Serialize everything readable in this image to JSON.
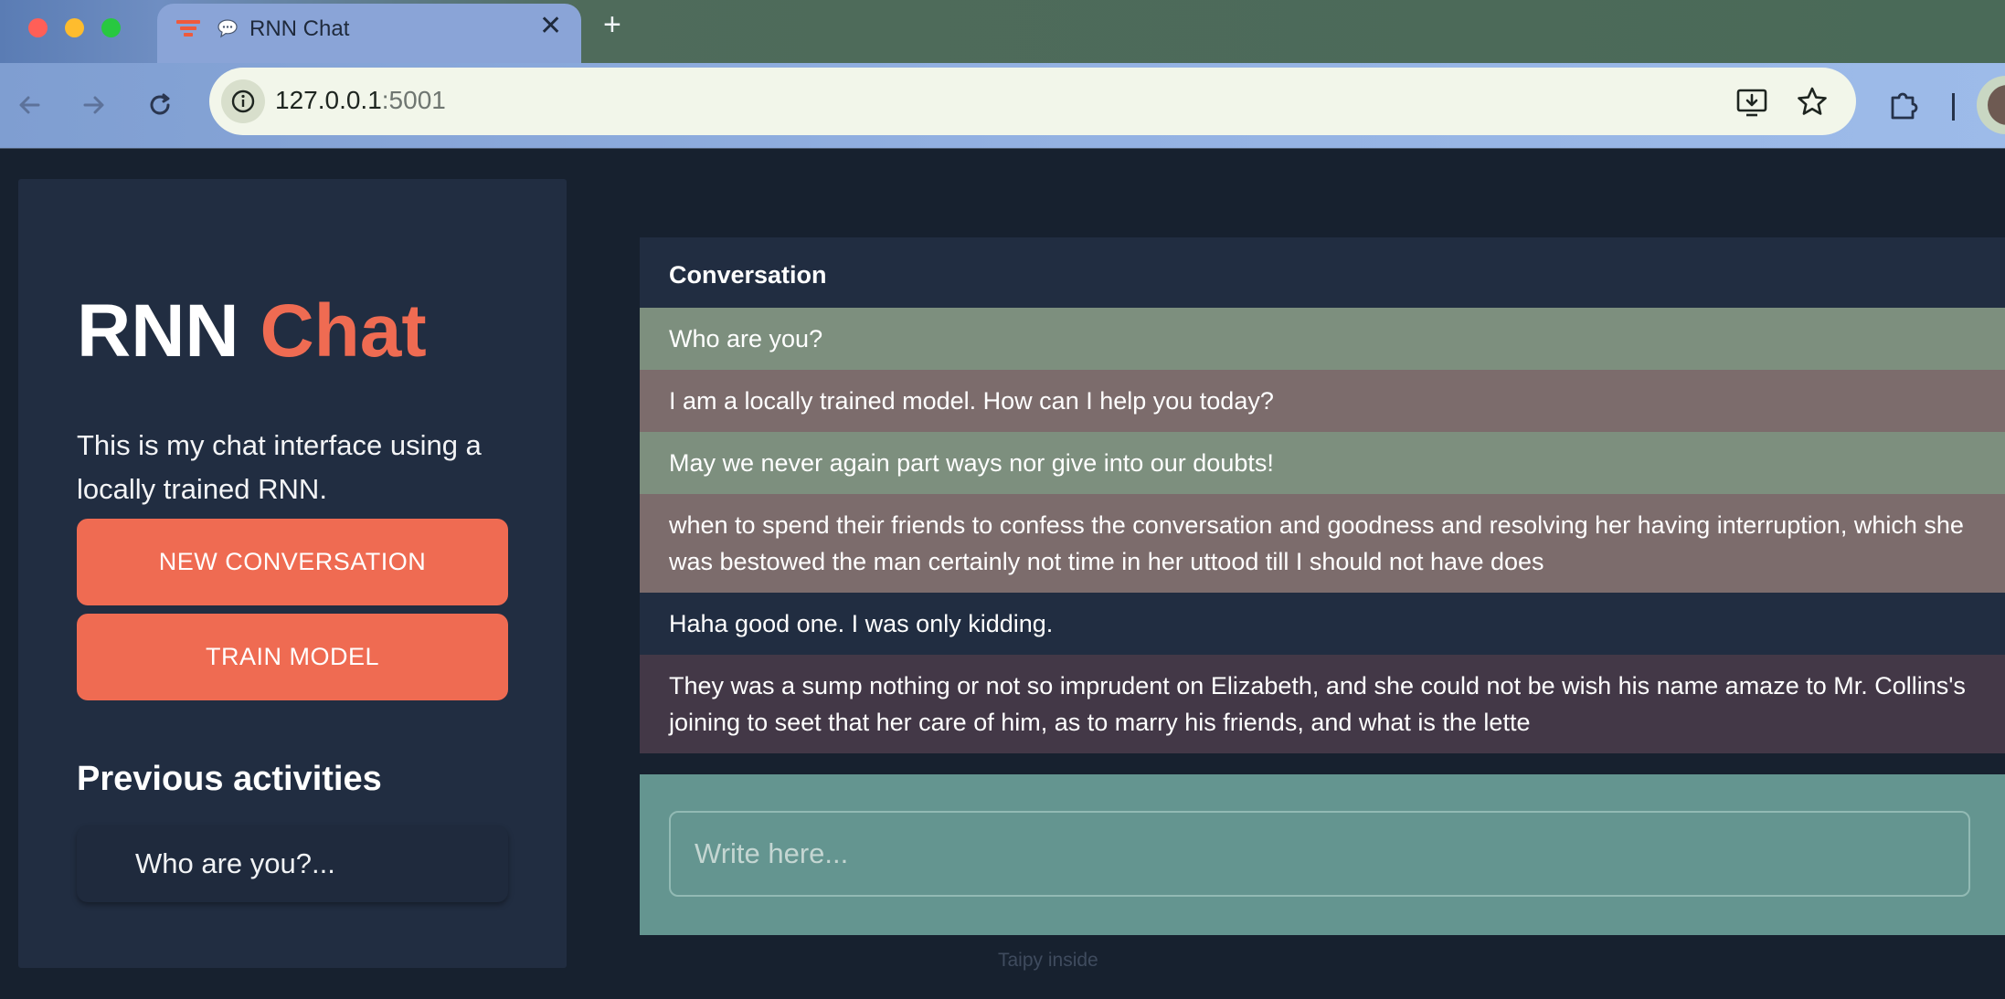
{
  "browser": {
    "tab_title": "RNN Chat",
    "tab_close": "✕",
    "new_tab": "+",
    "url_host": "127.0.0.1",
    "url_port": ":5001"
  },
  "sidebar": {
    "brand_main": "RNN",
    "brand_accent": "Chat",
    "description": "This is my chat interface using a locally trained RNN.",
    "new_conversation_label": "NEW CONVERSATION",
    "train_model_label": "TRAIN MODEL",
    "previous_title": "Previous activities",
    "previous_items": [
      "Who are you?..."
    ]
  },
  "conversation": {
    "title": "Conversation",
    "messages": [
      {
        "role": "user",
        "text": "Who are you?"
      },
      {
        "role": "bot",
        "text": "I am a locally trained model. How can I help you today?"
      },
      {
        "role": "user",
        "text": "May we never again part ways nor give into our doubts!"
      },
      {
        "role": "bot",
        "text": "when to spend their friends to confess the conversation and goodness and resolving her having interruption, which she was bestowed the man certainly not time in her uttood till I should not have does"
      },
      {
        "role": "user",
        "text": "Haha good one. I was only kidding."
      },
      {
        "role": "bot",
        "text": "They was a sump nothing or not so imprudent on Elizabeth, and she could not be wish his name amaze to Mr. Collins's joining to seet that her care of him, as to marry his friends, and what is the lette"
      }
    ]
  },
  "input": {
    "placeholder": "Write here..."
  },
  "footer": "Taipy inside",
  "colors": {
    "accent": "#ef6b52",
    "page_bg": "#17212f",
    "panel_bg": "#212d41",
    "user_bubble": "#7d8f7e",
    "bot_bubble": "#7c6c6c",
    "input_bg": "#649590"
  },
  "icons": {
    "back": "arrow-left-icon",
    "forward": "arrow-right-icon",
    "reload": "reload-icon",
    "site_info": "info-icon",
    "install": "install-app-icon",
    "bookmark": "star-icon",
    "extensions": "puzzle-icon"
  }
}
